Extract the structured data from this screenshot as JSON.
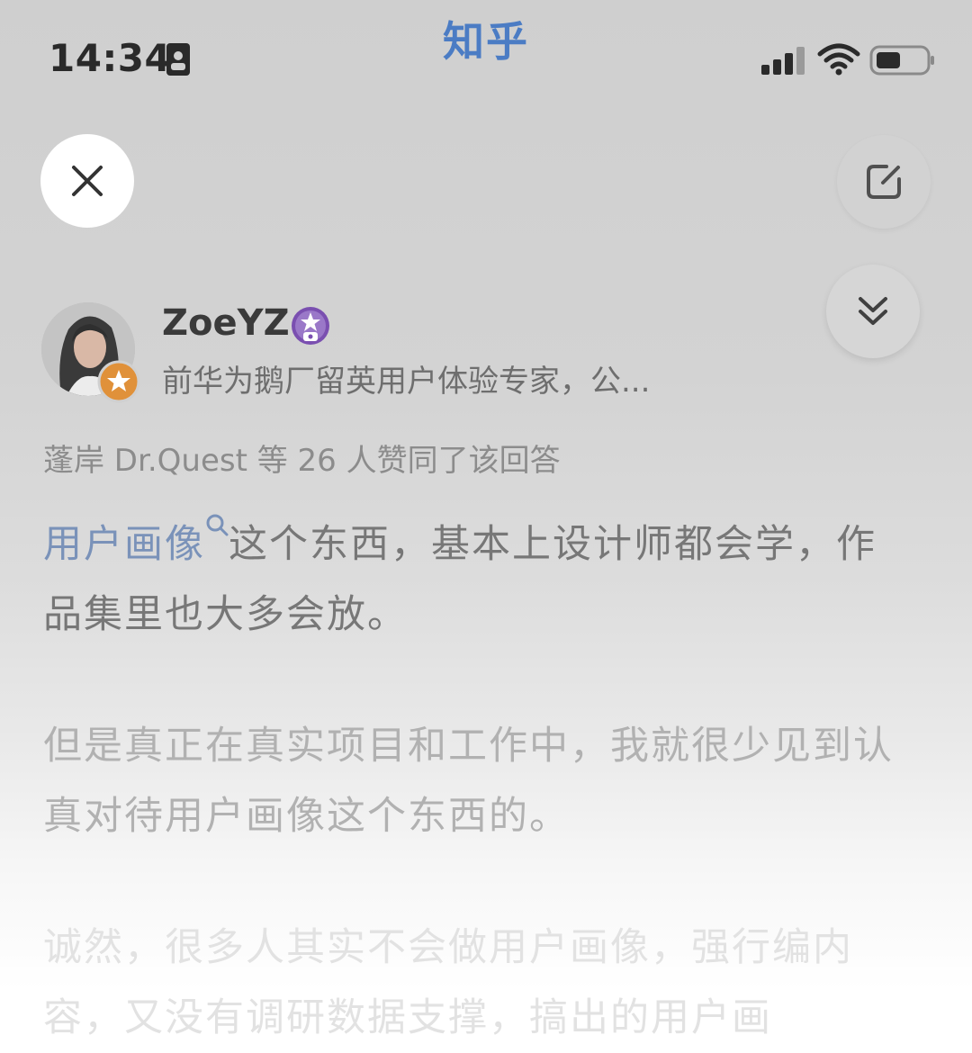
{
  "status_bar": {
    "time": "14:34",
    "app_title": "知乎",
    "icons": [
      "sim-card-icon",
      "cellular-signal-icon",
      "wifi-icon",
      "battery-icon"
    ]
  },
  "toolbar": {
    "close_icon": "close-icon",
    "edit_icon": "edit-icon",
    "collapse_icon": "double-chevron-down-icon"
  },
  "author": {
    "name": "ZoeYZ",
    "bio": "前华为鹅厂留英用户体验专家，公...",
    "badge_icon": "creator-badge-icon",
    "verified_icon": "star-verified-icon"
  },
  "upvote_info": "蓬岸 Dr.Quest 等 26 人赞同了该回答",
  "answer": {
    "paragraph1": {
      "link_text": "用户画像",
      "text": "这个东西，基本上设计师都会学，作品集里也大多会放。"
    },
    "paragraph2": "但是真正在真实项目和工作中，我就很少见到认真对待用户画像这个东西的。",
    "paragraph3": "诚然，很多人其实不会做用户画像，强行编内容，又没有调研数据支撑，搞出的用户画"
  },
  "colors": {
    "brand_blue": "#4b7cc4",
    "link_blue": "#7a92b9",
    "badge_orange": "#e0913a",
    "badge_purple": "#7a4fb0"
  }
}
